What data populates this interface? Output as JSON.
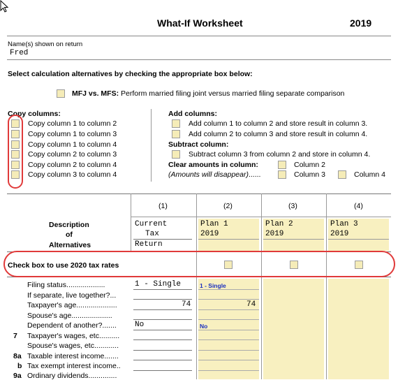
{
  "header": {
    "title": "What-If Worksheet",
    "year": "2019"
  },
  "names": {
    "label": "Name(s) shown on return",
    "value": "Fred"
  },
  "instructions": "Select calculation alternatives by checking the appropriate box below:",
  "mfj": {
    "bold": "MFJ vs. MFS:",
    "text": "Perform married filing joint versus married filing separate comparison"
  },
  "copy": {
    "heading": "Copy columns:",
    "items": [
      "Copy column 1 to column 2",
      "Copy column 1 to column 3",
      "Copy column 1 to column 4",
      "Copy column 2 to column 3",
      "Copy column 2 to column 4",
      "Copy column 3 to column 4"
    ]
  },
  "add": {
    "heading": "Add columns:",
    "items": [
      "Add column 1 to column 2 and store result in column 3.",
      "Add column 2 to column 3 and store result in column 4."
    ]
  },
  "subtract": {
    "heading": "Subtract column:",
    "item": "Subtract column 3 from column 2 and store in column 4."
  },
  "clear": {
    "heading": "Clear amounts in column:",
    "note": "(Amounts will disappear)",
    "dots": "......",
    "col2": "Column 2",
    "col3": "Column 3",
    "col4": "Column 4"
  },
  "table": {
    "col_numbers": [
      "(1)",
      "(2)",
      "(3)",
      "(4)"
    ],
    "description": [
      "Description",
      "of",
      "Alternatives"
    ],
    "col1": [
      "Current",
      "Tax",
      "Return"
    ],
    "plans": [
      {
        "name": "Plan 1",
        "year": "2019"
      },
      {
        "name": "Plan 2",
        "year": "2019"
      },
      {
        "name": "Plan 3",
        "year": "2019"
      }
    ],
    "checkbox_label": "Check box to use 2020 tax rates"
  },
  "rows": [
    {
      "num": "",
      "label": "Filing status",
      "dots": "...................",
      "c1": "1 - Single",
      "c2": "1 - Single"
    },
    {
      "num": "",
      "label": "If separate, live together?",
      "dots": "...",
      "c1": "",
      "c2": ""
    },
    {
      "num": "",
      "label": "Taxpayer's age",
      "dots": "....................",
      "c1": "74",
      "c2": "74"
    },
    {
      "num": "",
      "label": "Spouse's age",
      "dots": "....................",
      "c1": "",
      "c2": ""
    },
    {
      "num": "",
      "label": "Dependent of another?",
      "dots": ".......",
      "c1": "No",
      "c2": "No"
    },
    {
      "num": "7",
      "label": "Taxpayer's wages, etc.",
      "dots": ".........",
      "c1": "",
      "c2": ""
    },
    {
      "num": "",
      "label": "Spouse's wages, etc.",
      "dots": "...........",
      "c1": "",
      "c2": ""
    },
    {
      "num": "8a",
      "label": "Taxable interest income",
      "dots": ".......",
      "c1": "",
      "c2": ""
    },
    {
      "num": "b",
      "label": "Tax exempt interest income",
      "dots": "..",
      "c1": "",
      "c2": ""
    },
    {
      "num": "9a",
      "label": "Ordinary dividends",
      "dots": "..............",
      "c1": "",
      "c2": ""
    }
  ],
  "colors": {
    "field": "#f8f0c0",
    "annotation": "#e03a3a",
    "blue_text": "#1a2fc0"
  }
}
